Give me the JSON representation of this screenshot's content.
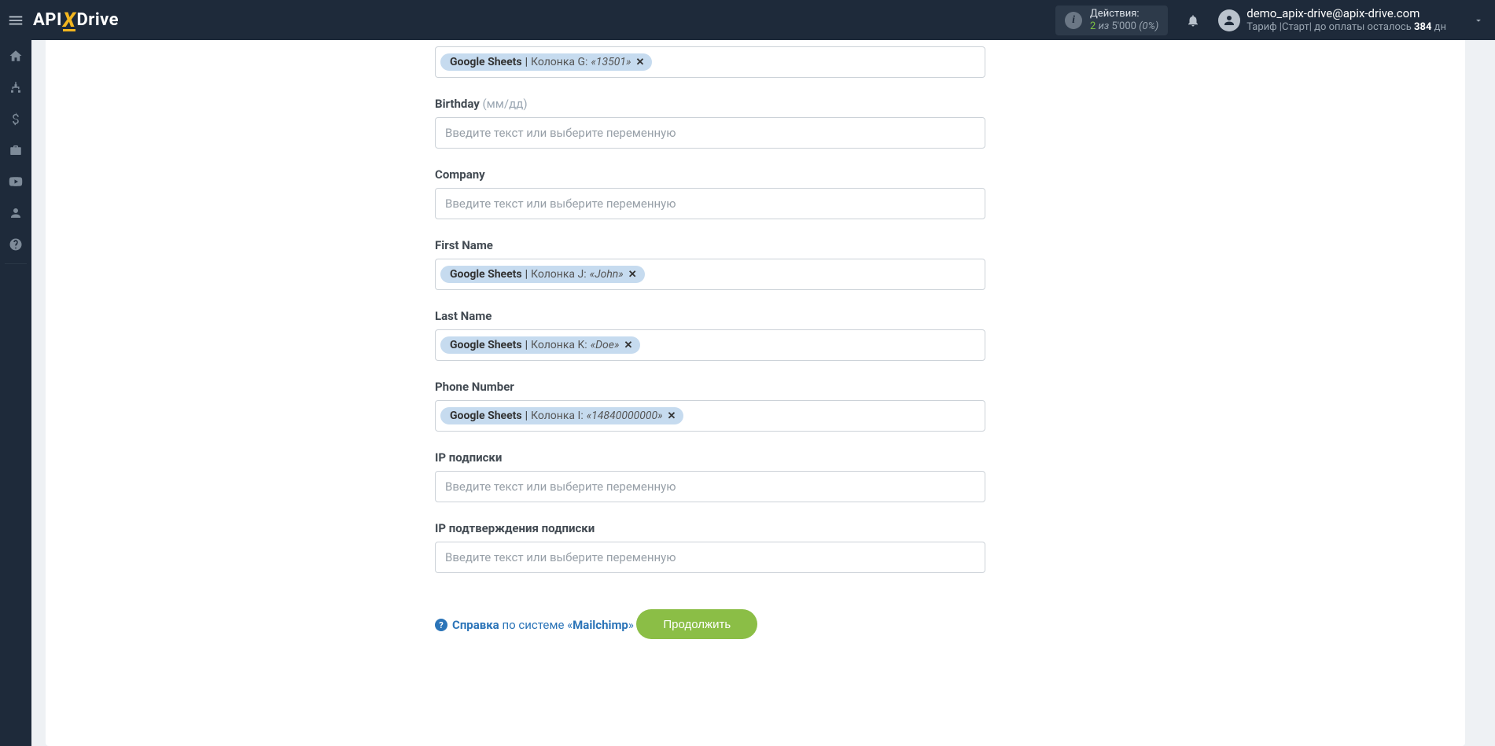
{
  "header": {
    "logo": {
      "api": "API",
      "x": "X",
      "drive": "Drive"
    },
    "actions": {
      "title": "Действия:",
      "used": "2",
      "sep": "из",
      "total": "5'000",
      "pct": "(0%)"
    },
    "user": {
      "email": "demo_apix-drive@apix-drive.com",
      "tariff_prefix": "Тариф |Старт| до оплаты осталось ",
      "tariff_days": "384",
      "tariff_suffix": " дн"
    }
  },
  "sidebar": {
    "icons": [
      "home",
      "sitemap",
      "dollar",
      "briefcase",
      "youtube",
      "user",
      "help"
    ]
  },
  "form": {
    "placeholder": "Введите текст или выберите переменную",
    "fields": [
      {
        "key": "address",
        "label": "",
        "hint": "",
        "chip": {
          "source": "Google Sheets",
          "column": "Колонка G:",
          "value": "«13501»"
        },
        "placeholder": ""
      },
      {
        "key": "birthday",
        "label": "Birthday",
        "hint": "(мм/дд)",
        "chip": null,
        "placeholder": "Введите текст или выберите переменную"
      },
      {
        "key": "company",
        "label": "Company",
        "hint": "",
        "chip": null,
        "placeholder": "Введите текст или выберите переменную"
      },
      {
        "key": "first_name",
        "label": "First Name",
        "hint": "",
        "chip": {
          "source": "Google Sheets",
          "column": "Колонка J:",
          "value": "«John»"
        },
        "placeholder": ""
      },
      {
        "key": "last_name",
        "label": "Last Name",
        "hint": "",
        "chip": {
          "source": "Google Sheets",
          "column": "Колонка K:",
          "value": "«Doe»"
        },
        "placeholder": ""
      },
      {
        "key": "phone",
        "label": "Phone Number",
        "hint": "",
        "chip": {
          "source": "Google Sheets",
          "column": "Колонка I:",
          "value": "«14840000000»"
        },
        "placeholder": ""
      },
      {
        "key": "ip_sub",
        "label": "IP подписки",
        "hint": "",
        "chip": null,
        "placeholder": "Введите текст или выберите переменную"
      },
      {
        "key": "ip_confirm",
        "label": "IP подтверждения подписки",
        "hint": "",
        "chip": null,
        "placeholder": "Введите текст или выберите переменную"
      }
    ],
    "help": {
      "label": "Справка",
      "mid": " по системе «",
      "system": "Mailchimp",
      "end": "»"
    },
    "continue": "Продолжить"
  }
}
